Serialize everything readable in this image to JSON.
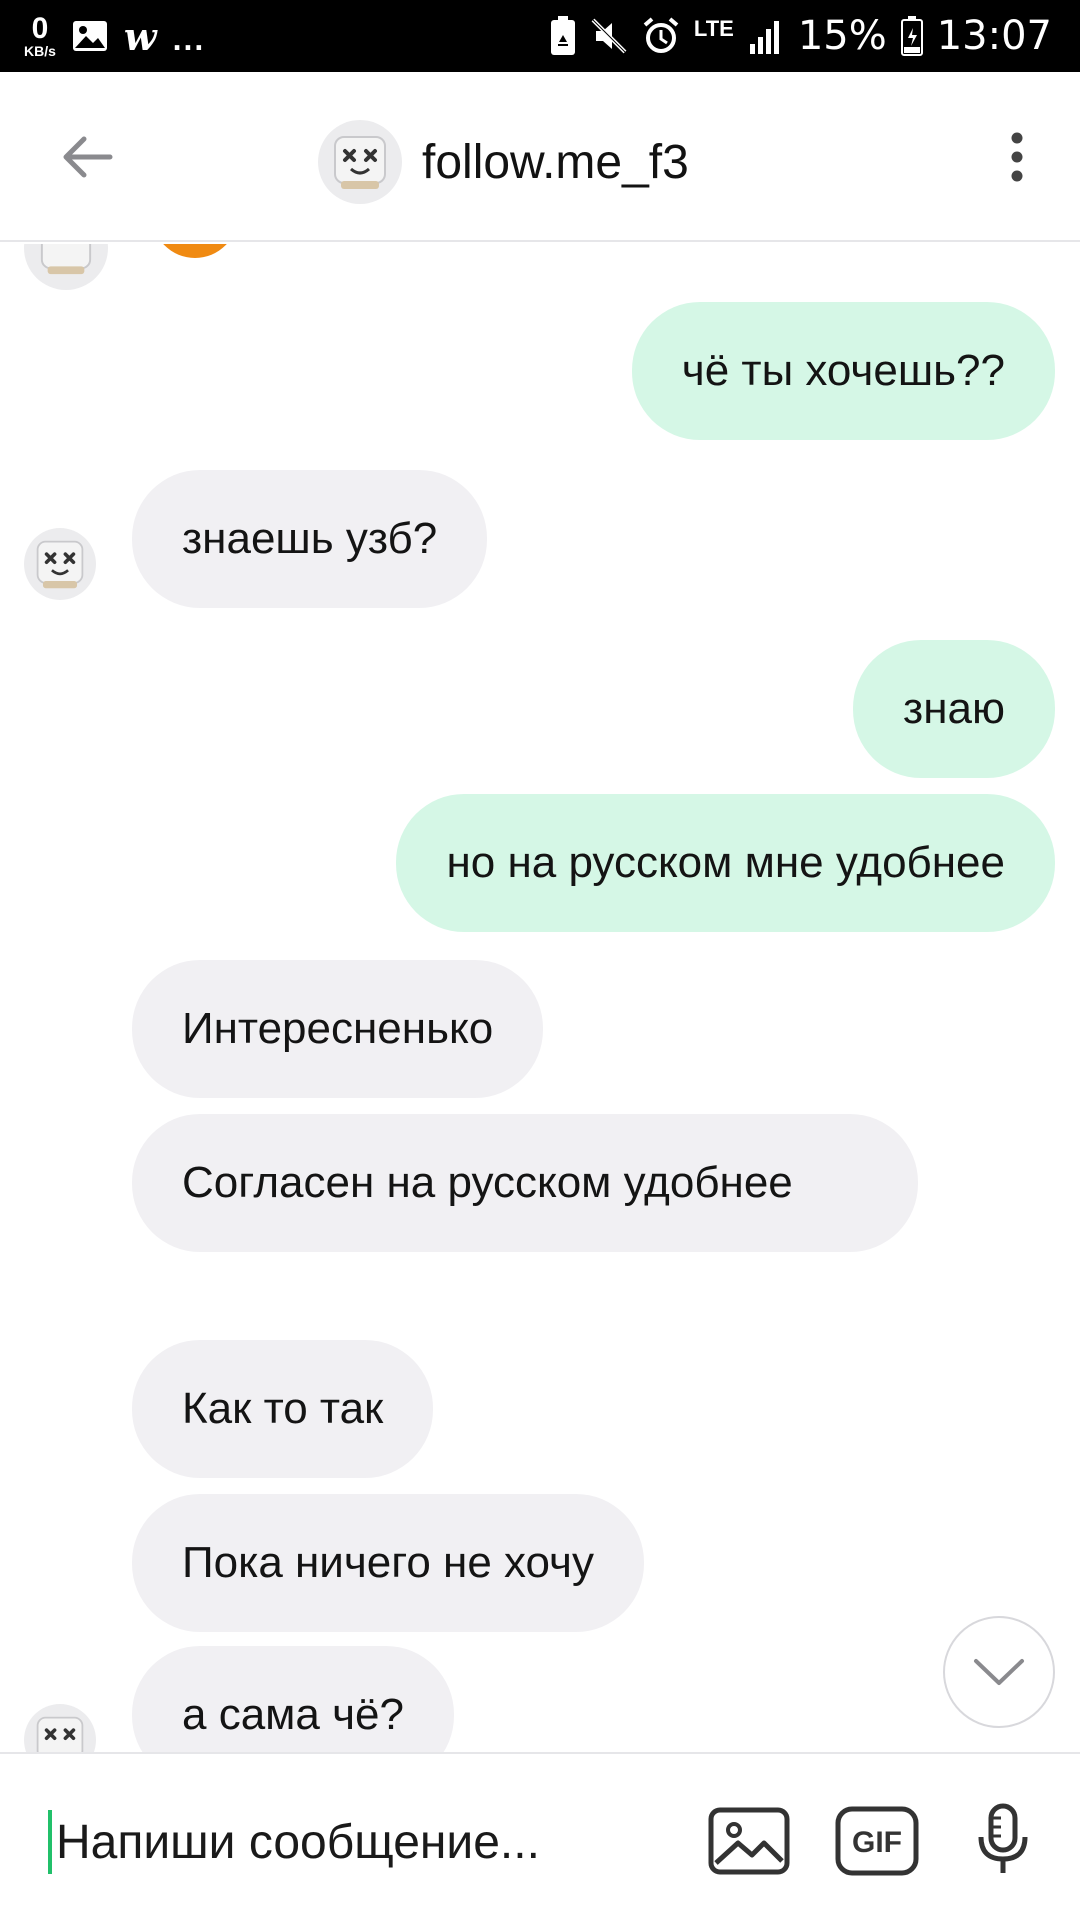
{
  "status_bar": {
    "net_speed_value": "0",
    "net_speed_unit": "KB/s",
    "more_indicator": "...",
    "network_type": "LTE",
    "battery": "15%",
    "time": "13:07"
  },
  "header": {
    "title": "follow.me_f3"
  },
  "messages": [
    {
      "from": "me",
      "text": "чё ты хочешь??"
    },
    {
      "from": "them",
      "text": "знаешь узб?"
    },
    {
      "from": "me",
      "text": "знаю"
    },
    {
      "from": "me",
      "text": "но на русском мне удобнее"
    },
    {
      "from": "them",
      "text": "Интересненько"
    },
    {
      "from": "them",
      "text": "Согласен на русском удобнее"
    },
    {
      "from": "them",
      "text": "Как то так"
    },
    {
      "from": "them",
      "text": "Пока ничего не хочу"
    },
    {
      "from": "them",
      "text": "а сама чё?"
    }
  ],
  "composer": {
    "placeholder": "Напиши сообщение...",
    "gif_label": "GIF"
  },
  "colors": {
    "my_bubble": "#d5f7e6",
    "their_bubble": "#f1f0f3",
    "accent": "#21c06a"
  }
}
